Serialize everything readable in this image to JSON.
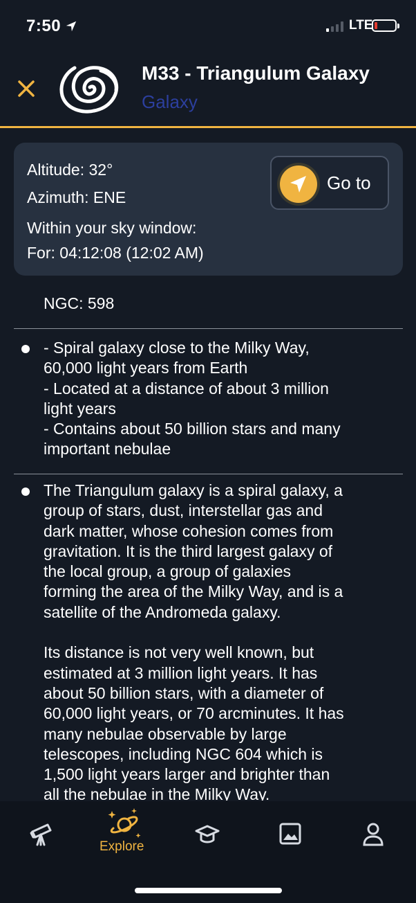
{
  "status_bar": {
    "time": "7:50",
    "network": "LTE",
    "icons": [
      "location-arrow-icon",
      "signal-icon",
      "battery-icon"
    ]
  },
  "header": {
    "title": "M33 - Triangulum Galaxy",
    "type": "Galaxy",
    "close_icon": "close-icon",
    "logo_icon": "spiral-galaxy-icon"
  },
  "info": {
    "altitude": "Altitude: 32°",
    "azimuth": "Azimuth: ENE",
    "sky_window": "Within your sky window:",
    "for_time": "For:  04:12:08 (12:02 AM)",
    "goto_label": "Go to",
    "goto_icon": "navigation-arrow-icon"
  },
  "ngc": "NGC:  598",
  "facts": "- Spiral galaxy close to the Milky Way,\n60,000 light years from Earth\n- Located at a distance of about 3 million\nlight years\n- Contains about 50 billion stars and many\nimportant nebulae",
  "description": "The Triangulum galaxy is a spiral galaxy, a\ngroup of stars, dust, interstellar gas and\ndark matter, whose cohesion comes from\ngravitation. It is the third largest galaxy of\nthe local group, a group of galaxies\nforming the area of the Milky Way, and is a\nsatellite of the Andromeda galaxy.\n\nIts distance is not very well known, but\nestimated at 3 million light years. It has\nabout 50 billion stars, with a diameter of\n60,000 light years, or 70 arcminutes. It has\nmany nebulae observable by large\ntelescopes, including NGC 604 which is\n1,500 light years larger and brighter than\nall the nebulae in the Milky Way.",
  "tabs": [
    {
      "icon": "telescope-icon",
      "label": ""
    },
    {
      "icon": "planet-icon",
      "label": "Explore",
      "active": true
    },
    {
      "icon": "graduation-cap-icon",
      "label": ""
    },
    {
      "icon": "image-icon",
      "label": ""
    },
    {
      "icon": "profile-icon",
      "label": ""
    }
  ],
  "colors": {
    "background": "#141a24",
    "accent": "#f0b441",
    "card": "#273140",
    "type_label": "#2c3f9e"
  }
}
